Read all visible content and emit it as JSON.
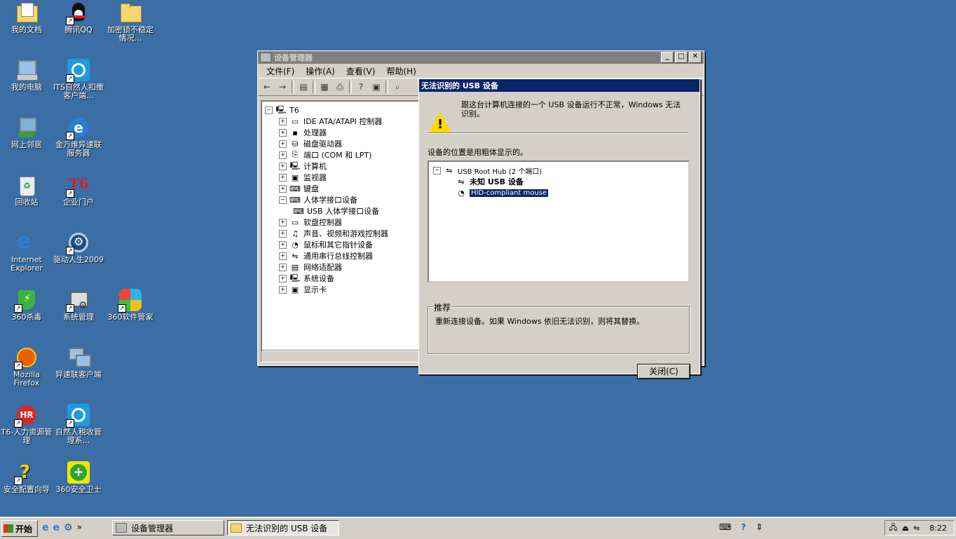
{
  "desktop": {
    "icons": [
      {
        "label": "我的文档"
      },
      {
        "label": "腾讯QQ"
      },
      {
        "label": "加密锁不稳定情况..."
      },
      {
        "label": "我的电脑"
      },
      {
        "label": "ITS自然人扣缴客户端..."
      },
      {
        "label": "网上邻居"
      },
      {
        "label": "金万维异速联服务器"
      },
      {
        "label": "回收站"
      },
      {
        "label": "企业门户"
      },
      {
        "label": "Internet Explorer"
      },
      {
        "label": "驱动人生2009"
      },
      {
        "label": "360杀毒"
      },
      {
        "label": "系统管理"
      },
      {
        "label": "360软件管家"
      },
      {
        "label": "Mozilla Firefox"
      },
      {
        "label": "异速联客户端"
      },
      {
        "label": "T6-人力资源管理"
      },
      {
        "label": "自然人税收管理系..."
      },
      {
        "label": "安全配置向导"
      },
      {
        "label": "360安全卫士"
      }
    ],
    "t6_logo": "T6",
    "hr_logo": "HR"
  },
  "device_manager": {
    "title": "设备管理器",
    "menu": [
      "文件(F)",
      "操作(A)",
      "查看(V)",
      "帮助(H)"
    ],
    "root": "T6",
    "tree": [
      {
        "label": "IDE ATA/ATAPI 控制器"
      },
      {
        "label": "处理器"
      },
      {
        "label": "磁盘驱动器"
      },
      {
        "label": "端口 (COM 和 LPT)"
      },
      {
        "label": "计算机"
      },
      {
        "label": "监视器"
      },
      {
        "label": "键盘"
      },
      {
        "label": "人体学接口设备"
      },
      {
        "label": "USB 人体学接口设备",
        "child": true
      },
      {
        "label": "软盘控制器"
      },
      {
        "label": "声音、视频和游戏控制器"
      },
      {
        "label": "鼠标和其它指针设备"
      },
      {
        "label": "通用串行总线控制器"
      },
      {
        "label": "网络适配器"
      },
      {
        "label": "系统设备"
      },
      {
        "label": "显示卡"
      }
    ]
  },
  "dialog": {
    "title": "无法识别的 USB 设备",
    "message": "跟这台计算机连接的一个 USB 设备运行不正常，Windows 无法识别。",
    "location_label": "设备的位置是用粗体显示的。",
    "tree": {
      "hub": "USB Root Hub (2 个端口)",
      "unknown": "未知 USB 设备",
      "mouse": "HID-compliant mouse"
    },
    "recommend_title": "推荐",
    "recommend_text": "重新连接设备。如果 Windows 依旧无法识别，则将其替换。",
    "close_button": "关闭(C)"
  },
  "taskbar": {
    "start": "开始",
    "tasks": [
      "设备管理器",
      "无法识别的 USB 设备"
    ],
    "clock": "8:22",
    "quicklaunch_more": "»"
  },
  "colors": {
    "desktop": "#3a6ea5",
    "active_title": "#0a246a",
    "inactive_title": "#808080",
    "face": "#d4d0c8"
  }
}
